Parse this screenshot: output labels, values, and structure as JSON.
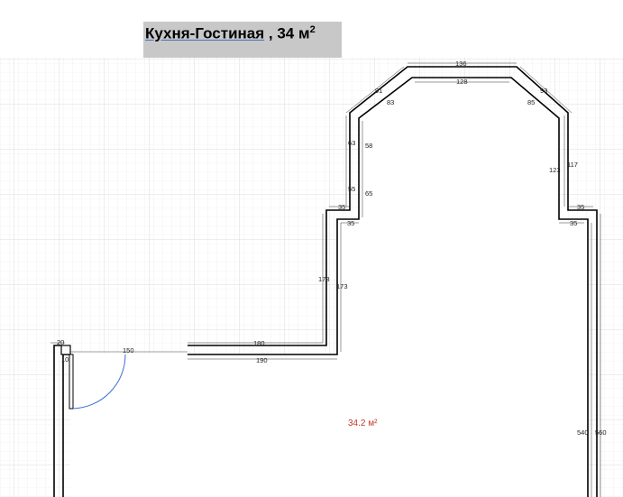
{
  "title": {
    "room_name": "Кухня-Гостиная",
    "separator": " , ",
    "area_value": "34 м",
    "area_sup": "2"
  },
  "area_label": "34.2 м²",
  "colors": {
    "grid_minor": "#e6e6e6",
    "grid_major": "#cfcfcf",
    "wall": "#000000",
    "wall_fill": "#ffffff",
    "door_arc": "#3a6fd8",
    "area_text": "#c0392b",
    "title_bg": "#c8c8c8"
  },
  "dimensions": {
    "top_outer": "136",
    "top_inner": "128",
    "diag_left_outer": "91",
    "diag_left_inner": "83",
    "diag_right_outer": "93",
    "diag_right_inner": "85",
    "left_upper_outer": "63",
    "left_upper_inner": "58",
    "left_lower_outer": "55",
    "left_lower_inner": "65",
    "ledge_left_outer": "35",
    "ledge_left_inner": "35",
    "ledge_right_outer": "35",
    "ledge_right_inner": "35",
    "right_upper_inner": "123",
    "right_upper_outer": "117",
    "mid_left_outer": "173",
    "mid_left_inner": "173",
    "horizontal_outer": "180",
    "horizontal_inner": "190",
    "door_width": "150",
    "wall_end_outer": "20",
    "wall_end_inner": "10",
    "right_long_inner": "540",
    "right_long_outer": "560"
  }
}
